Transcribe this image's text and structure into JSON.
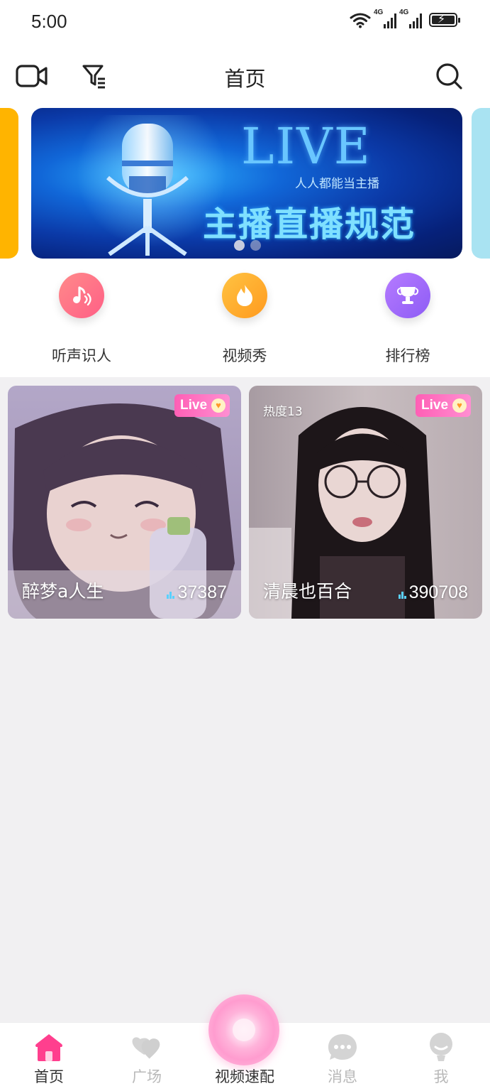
{
  "status": {
    "time": "5:00",
    "net1": "4G",
    "net2": "4G"
  },
  "header": {
    "title": "首页",
    "left_icons": [
      "video-camera-icon",
      "filter-icon"
    ],
    "right_icon": "search-icon"
  },
  "banner": {
    "live_text": "LIVE",
    "subtitle": "人人都能当主播",
    "headline": "主播直播规范",
    "page_count": 2,
    "active_page": 1
  },
  "quick_links": [
    {
      "label": "听声识人",
      "icon": "music-note-icon",
      "color_from": "#ff8a8a",
      "color_to": "#ff5f86"
    },
    {
      "label": "视频秀",
      "icon": "flame-icon",
      "color_from": "#ffc342",
      "color_to": "#ff9a1f"
    },
    {
      "label": "排行榜",
      "icon": "trophy-icon",
      "color_from": "#b67bff",
      "color_to": "#8d5cf5"
    }
  ],
  "streams": [
    {
      "name": "醉梦a人生",
      "viewers": "37387",
      "live_label": "Live",
      "heat": ""
    },
    {
      "name": "清晨也百合",
      "viewers": "390708",
      "live_label": "Live",
      "heat": "热度13"
    }
  ],
  "tabbar": {
    "tabs": [
      {
        "label": "首页",
        "icon": "home-icon",
        "active": true
      },
      {
        "label": "广场",
        "icon": "hearts-icon",
        "active": false
      },
      {
        "label": "视频速配",
        "icon": "video-match-icon",
        "active": false
      },
      {
        "label": "消息",
        "icon": "chat-icon",
        "active": false
      },
      {
        "label": "我",
        "icon": "profile-icon",
        "active": false
      }
    ]
  },
  "colors": {
    "accent": "#ff3f8e",
    "background": "#f1f0f2"
  }
}
